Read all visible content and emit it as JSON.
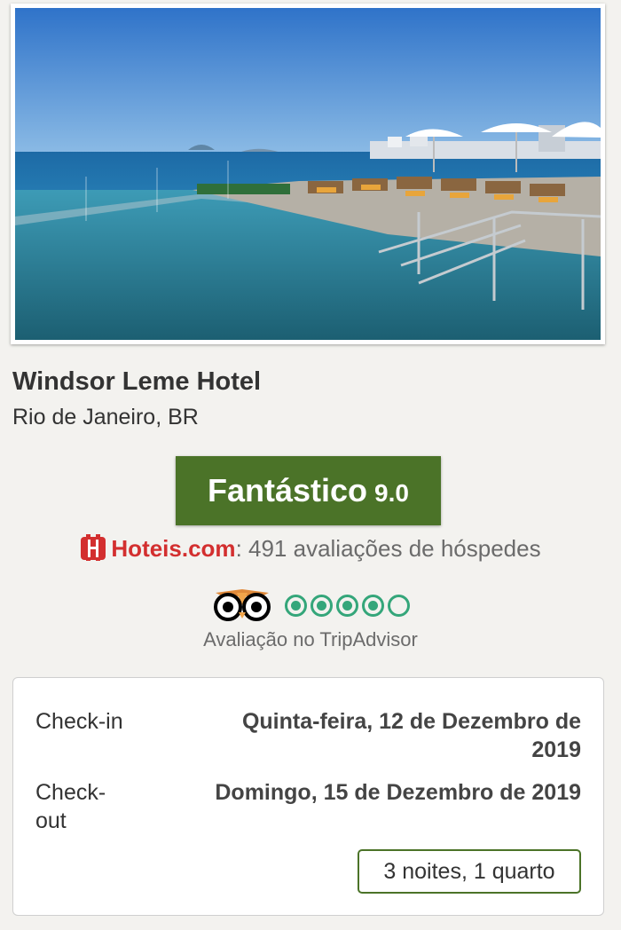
{
  "hotel": {
    "name": "Windsor Leme Hotel",
    "location": "Rio de Janeiro, BR"
  },
  "rating": {
    "label": "Fantástico",
    "score": "9.0",
    "color": "#4b7328"
  },
  "hotels_com": {
    "brand": "Hoteis.com",
    "reviews_text": ": 491 avaliações de hóspedes",
    "brand_color": "#d32f2f"
  },
  "tripadvisor": {
    "caption": "Avaliação no TripAdvisor",
    "bubbles_rating": 4,
    "bubbles_max": 5,
    "bubble_color": "#34a67a",
    "icon": "tripadvisor-owl-icon"
  },
  "booking": {
    "checkin_label": "Check-in",
    "checkin_value": "Quinta-feira, 12 de Dezembro de 2019",
    "checkout_label": "Check-out",
    "checkout_value": "Domingo, 15 de Dezembro de 2019",
    "stay_summary": "3 noites, 1 quarto"
  },
  "photo": {
    "icon": "hotel-rooftop-pool-photo"
  }
}
